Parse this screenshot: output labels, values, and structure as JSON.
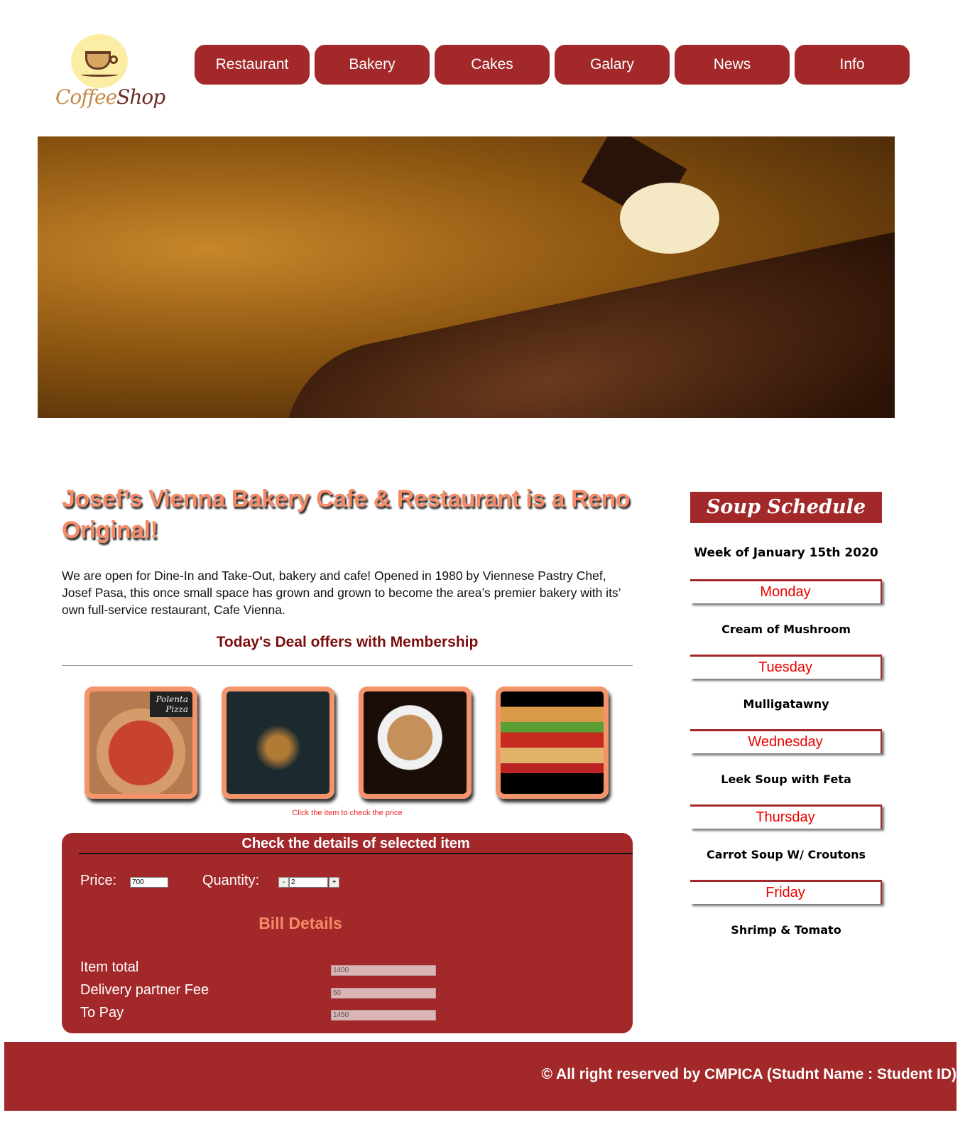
{
  "logo": {
    "text_a": "Coffee",
    "text_b": "Shop"
  },
  "nav": [
    "Restaurant",
    "Bakery",
    "Cakes",
    "Galary",
    "News",
    "Info"
  ],
  "main": {
    "title": "Josef’s Vienna Bakery Cafe & Restaurant is a Reno Original!",
    "intro": "We are open for Dine-In and Take-Out, bakery and cafe! Opened in 1980 by Viennese Pastry Chef, Josef Pasa, this once small space has grown and grown to become the area’s premier bakery with its’ own full-service restaurant, Cafe Vienna.",
    "deal": "Today's Deal offers with Membership",
    "thumb_caption": "Polenta Pizza",
    "hint": "Click the item to check the price"
  },
  "panel": {
    "title": "Check the details of selected item",
    "price_label": "Price:",
    "price": "700",
    "qty_label": "Quantity:",
    "qty": "2",
    "minus": "-",
    "plus": "+",
    "bill_title": "Bill Details",
    "rows": [
      {
        "label": "Item total",
        "value": "1400"
      },
      {
        "label": "Delivery partner Fee",
        "value": "50"
      },
      {
        "label": "To Pay",
        "value": "1450"
      }
    ]
  },
  "schedule": {
    "title": "Soup Schedule",
    "week": "Week of January 15th 2020",
    "days": [
      {
        "day": "Monday",
        "soup": "Cream of Mushroom"
      },
      {
        "day": "Tuesday",
        "soup": "Mulligatawny"
      },
      {
        "day": "Wednesday",
        "soup": "Leek Soup with Feta"
      },
      {
        "day": "Thursday",
        "soup": "Carrot Soup W/ Croutons"
      },
      {
        "day": "Friday",
        "soup": "Shrimp & Tomato"
      }
    ]
  },
  "footer": "© All right reserved by CMPICA (Studnt Name : Student ID)",
  "colors": {
    "brand": "#a3282a",
    "accent": "#f58a66"
  }
}
